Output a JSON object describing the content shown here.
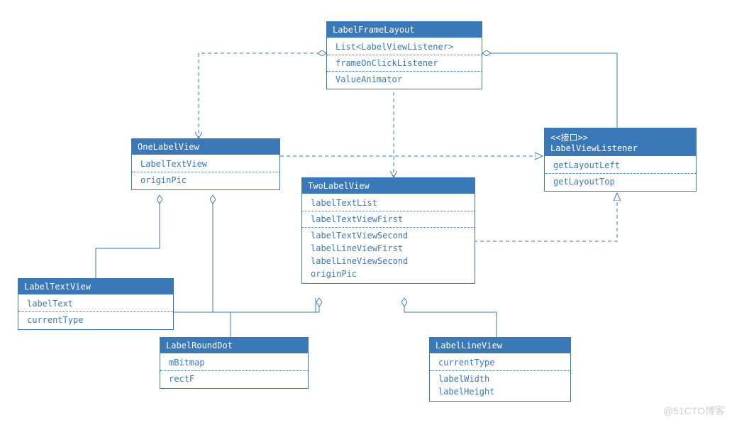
{
  "watermark": "@51CTO博客",
  "classes": {
    "LabelFrameLayout": {
      "title": "LabelFrameLayout",
      "attrs1": [
        "List<LabelViewListener>"
      ],
      "attrs2": [
        "frameOnClickListener"
      ],
      "attrs3": [
        "ValueAnimator"
      ]
    },
    "OneLabelView": {
      "title": "OneLabelView",
      "attrs1": [
        "LabelTextView"
      ],
      "attrs2": [
        "originPic"
      ]
    },
    "TwoLabelView": {
      "title": "TwoLabelView",
      "attrs1": [
        "labelTextList"
      ],
      "attrs2": [
        "labelTextViewFirst"
      ],
      "attrs3": [
        "labelTextViewSecond",
        "labelLineViewFirst",
        "labelLineViewSecond",
        "originPic"
      ]
    },
    "LabelViewListener": {
      "stereo": "<<接口>>",
      "title": "LabelViewListener",
      "attrs1": [
        "getLayoutLeft"
      ],
      "attrs2": [
        "getLayoutTop"
      ]
    },
    "LabelTextView": {
      "title": "LabelTextView",
      "attrs1": [
        "labelText"
      ],
      "attrs2": [
        "currentType"
      ]
    },
    "LabelRoundDot": {
      "title": "LabelRoundDot",
      "attrs1": [
        "mBitmap"
      ],
      "attrs2": [
        "rectF"
      ]
    },
    "LabelLineView": {
      "title": "LabelLineView",
      "attrs1": [
        "currentType"
      ],
      "attrs2": [
        "labelWidth",
        "labelHeight"
      ]
    }
  }
}
